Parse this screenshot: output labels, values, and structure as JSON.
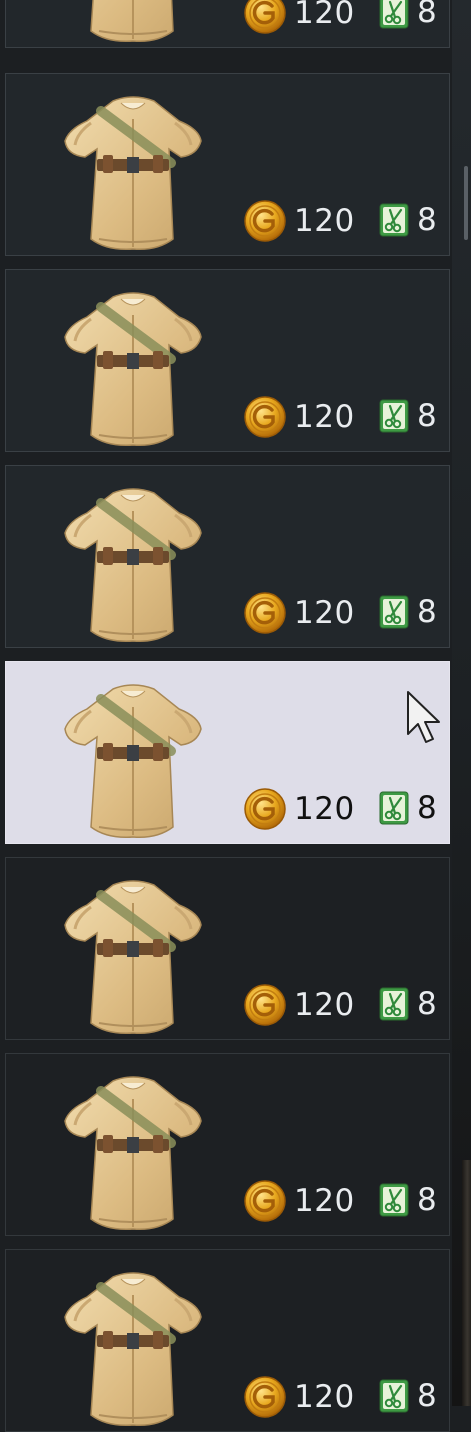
{
  "icons": {
    "currency": "gold-coin-icon",
    "parts": "scissors-parts-icon",
    "cursor": "mouse-cursor-icon"
  },
  "colors": {
    "card_background": "#22272b",
    "card_selected_background": "#dedde8",
    "coin_gold": "#e0a21a",
    "parts_green": "#4fae4a",
    "coat_tan": "#e3c48e"
  },
  "shop": {
    "items": [
      {
        "gold": "120",
        "parts": "8",
        "selected": false
      },
      {
        "gold": "120",
        "parts": "8",
        "selected": false
      },
      {
        "gold": "120",
        "parts": "8",
        "selected": false
      },
      {
        "gold": "120",
        "parts": "8",
        "selected": false
      },
      {
        "gold": "120",
        "parts": "8",
        "selected": true
      },
      {
        "gold": "120",
        "parts": "8",
        "selected": false
      },
      {
        "gold": "120",
        "parts": "8",
        "selected": false
      },
      {
        "gold": "120",
        "parts": "8",
        "selected": false
      }
    ]
  }
}
